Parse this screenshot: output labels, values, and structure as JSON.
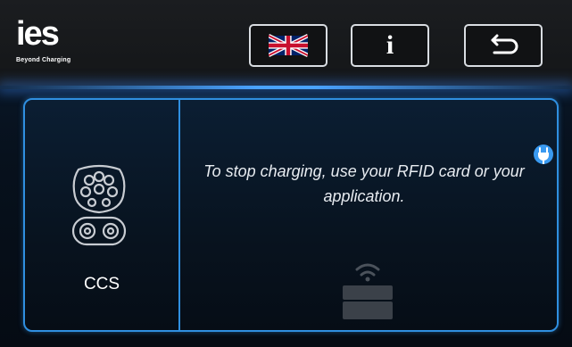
{
  "brand": {
    "logo_text": "ies",
    "tagline": "Beyond Charging"
  },
  "toolbar": {
    "language_icon": "uk-flag-icon",
    "info_label": "i",
    "back_icon": "return-arrow-icon"
  },
  "connector": {
    "icon": "ccs-connector-icon",
    "label": "CCS"
  },
  "status": {
    "message": "To stop charging, use your RFID card or your application.",
    "plug_icon": "plug-icon",
    "rfid_icon": "rfid-reader-icon"
  },
  "colors": {
    "accent": "#2f8fe0",
    "glow": "#4aa3ff",
    "text": "#ffffff"
  }
}
